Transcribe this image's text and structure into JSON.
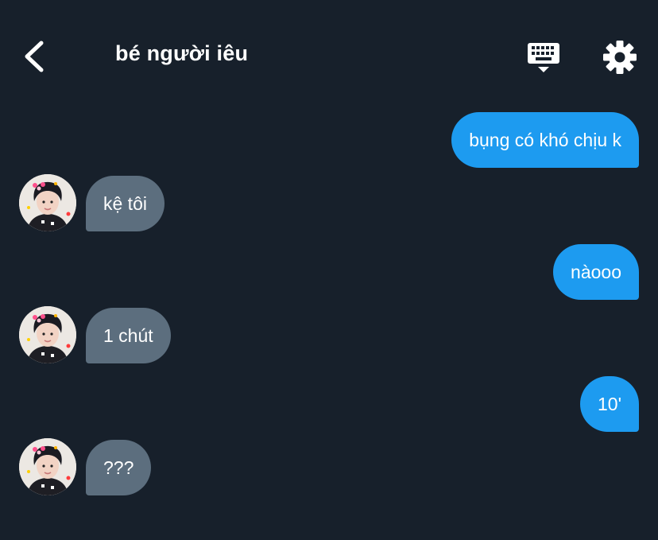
{
  "header": {
    "title": "bé người iêu",
    "back_icon": "chevron-left-icon",
    "keyboard_icon": "keyboard-icon",
    "settings_icon": "gear-icon"
  },
  "colors": {
    "background": "#17202b",
    "outgoing_bubble": "#1d9bf0",
    "incoming_bubble": "#5c6e7e",
    "text": "#ffffff"
  },
  "messages": [
    {
      "direction": "outgoing",
      "text": "bụng có khó chịu k"
    },
    {
      "direction": "incoming",
      "text": "kệ tôi"
    },
    {
      "direction": "outgoing",
      "text": "nàooo"
    },
    {
      "direction": "incoming",
      "text": "1 chút"
    },
    {
      "direction": "outgoing",
      "text": "10'"
    },
    {
      "direction": "incoming",
      "text": "???"
    }
  ]
}
